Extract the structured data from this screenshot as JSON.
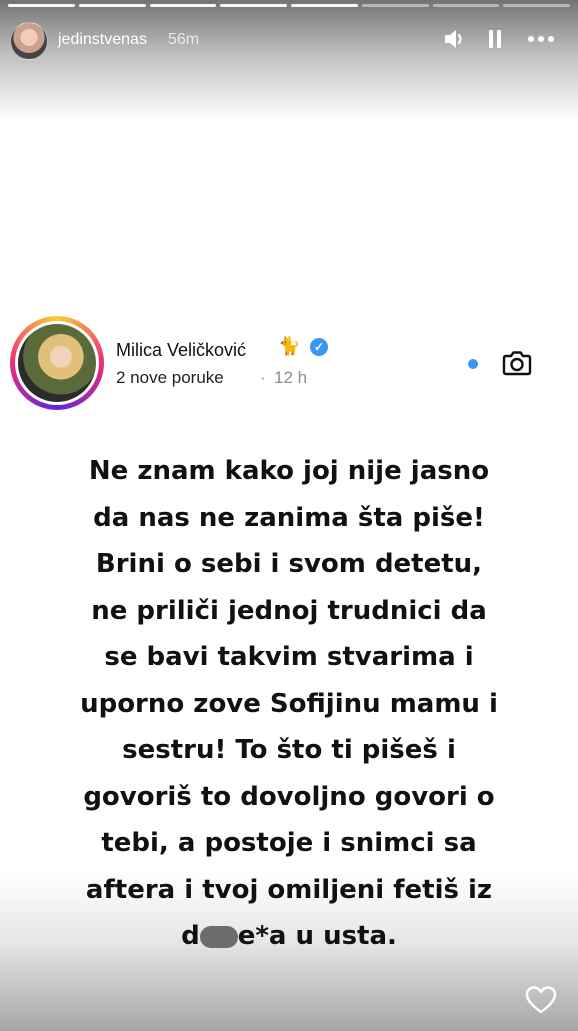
{
  "story": {
    "username": "jedinstvenas",
    "time_ago": "56m",
    "progress": {
      "segments": 8,
      "completed": 5
    }
  },
  "icons": {
    "sound": "volume-icon",
    "pause": "pause-icon",
    "more": "more-icon",
    "camera": "camera-icon",
    "like": "heart-icon",
    "verified": "verified-badge-icon"
  },
  "post": {
    "name": "Milica Veličković",
    "emoji": "🐈",
    "subtitle": "2 nove poruke",
    "separator": "·",
    "time": "12 h"
  },
  "message": {
    "lines": [
      "Ne znam kako joj nije jasno",
      "da nas ne zanima šta piše!",
      "Brini o sebi i svom detetu,",
      "ne priliči jednoj trudnici da",
      "se bavi takvim stvarima i",
      "uporno zove Sofijinu mamu i",
      "sestru! To što ti pišeš i",
      "govoriš to dovoljno govori o",
      "tebi, a postoje i snimci sa",
      "aftera i tvoj omiljeni fetiš iz"
    ],
    "last_line_start": "d",
    "last_line_end": "e*a u usta."
  },
  "colors": {
    "accent_blue": "#3897f0",
    "text": "#111111"
  }
}
